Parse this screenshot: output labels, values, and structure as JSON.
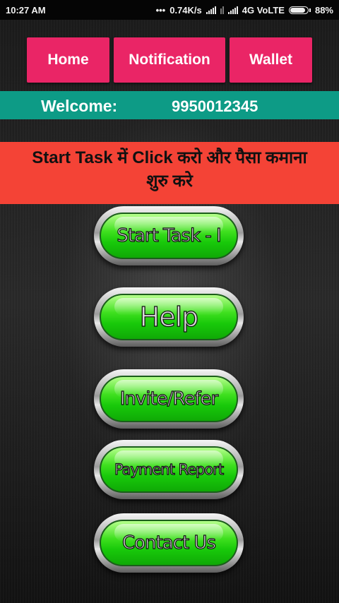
{
  "status_bar": {
    "time": "10:27 AM",
    "dots": "•••",
    "speed": "0.74K/s",
    "network": "4G VoLTE",
    "battery": "88%",
    "battery_level": 0.88
  },
  "nav": {
    "home": "Home",
    "notification": "Notification",
    "wallet": "Wallet"
  },
  "welcome": {
    "label": "Welcome:",
    "phone": "9950012345"
  },
  "banner": {
    "text": "Start Task में Click करो और पैसा कमाना शुरु करे"
  },
  "actions": {
    "start_task": "Start Task - I",
    "help": "Help",
    "invite": "Invite/Refer",
    "payment_report": "Payment Report",
    "contact": "Contact Us"
  },
  "colors": {
    "nav_button": "#ea2566",
    "welcome_bar": "#0d9b86",
    "banner": "#f44336",
    "action_green": "#18c90a"
  }
}
